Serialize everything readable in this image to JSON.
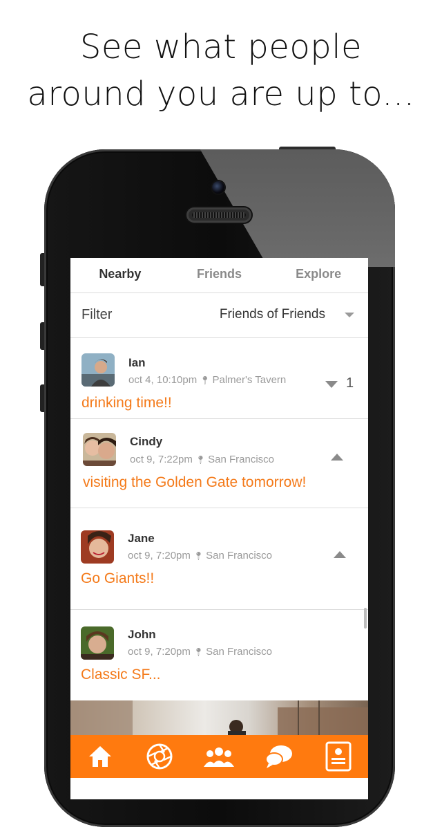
{
  "headline": {
    "line1": "See what people",
    "line2": "around you are up to..."
  },
  "tabs": [
    {
      "label": "Nearby",
      "active": true
    },
    {
      "label": "Friends",
      "active": false
    },
    {
      "label": "Explore",
      "active": false
    }
  ],
  "filter": {
    "label": "Filter",
    "value": "Friends of Friends"
  },
  "posts": [
    {
      "name": "Ian",
      "date": "oct 4, 10:10pm",
      "location": "Palmer's Tavern",
      "text": "drinking time!!",
      "vote_count": "1"
    },
    {
      "name": "Cindy",
      "date": "oct 9, 7:22pm",
      "location": "San Francisco",
      "text": "visiting the Golden Gate tomorrow!"
    },
    {
      "name": "Jane",
      "date": "oct 9, 7:20pm",
      "location": "San Francisco",
      "text": "Go Giants!!"
    },
    {
      "name": "John",
      "date": "oct 9, 7:20pm",
      "location": "San Francisco",
      "text": "Classic SF..."
    }
  ],
  "tabbar": {
    "items": [
      "home-icon",
      "camera-aperture-icon",
      "people-icon",
      "chat-bubbles-icon",
      "profile-card-icon"
    ]
  },
  "colors": {
    "accent": "#f47a1a",
    "tabbar": "#ff7a0f"
  }
}
